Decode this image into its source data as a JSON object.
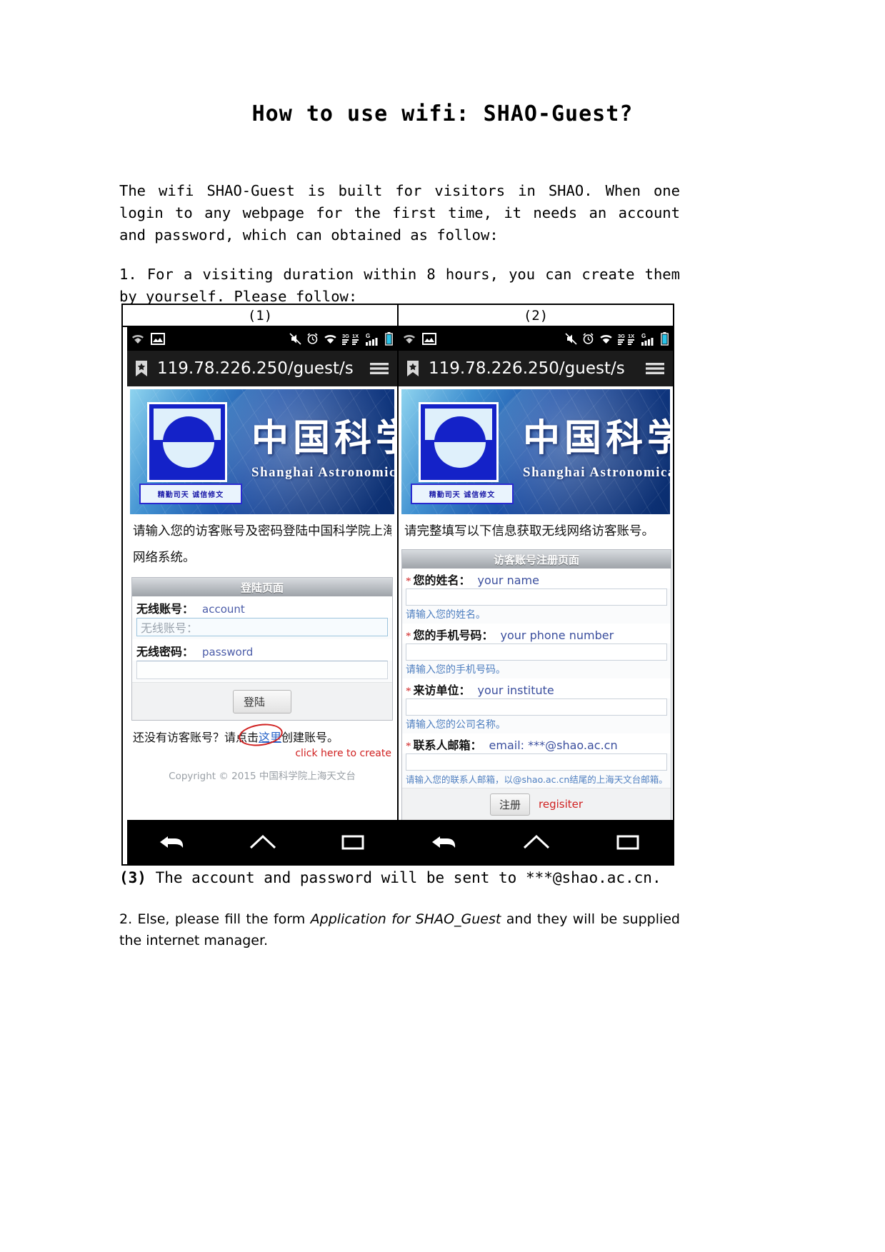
{
  "document": {
    "title": "How to use wifi: SHAO-Guest?",
    "intro": "The wifi SHAO-Guest is built for visitors in SHAO. When one login to any webpage for the first time, it needs an account and password, which can obtained as follow:",
    "step1": "1. For a visiting duration within 8 hours, you can create them by yourself. Please follow:",
    "step3_number": "(3)",
    "step3_text": "  The account and password will be sent to ***@shao.ac.cn.",
    "step2_prefix": "2. Else, please fill the form ",
    "step2_italic": "Application for SHAO_Guest",
    "step2_suffix": " and they will be supplied the internet manager."
  },
  "table": {
    "headers": [
      "(1)",
      "(2)"
    ]
  },
  "phone": {
    "statusbar": {
      "left_icons": [
        "wifi-question-icon",
        "image-icon"
      ],
      "right_icons": [
        "mute-icon",
        "alarm-clock-icon",
        "wifi-icon",
        "3g-1x-signal-icon",
        "g-signal-icon",
        "battery-icon"
      ]
    },
    "browser": {
      "bookmark_icon": "bookmark-star-icon",
      "url": "119.78.226.250/guest/s",
      "menu_icon": "hamburger-menu-icon"
    },
    "navbar": {
      "back": "back-arrow-icon",
      "home": "home-icon",
      "recents": "recents-square-icon"
    }
  },
  "banner": {
    "logo_motto": "精勤司天 诚信修文",
    "chinese_name": "中国科学",
    "english_name": "Shanghai Astronomical"
  },
  "panel1": {
    "lead_line1": "请输入您的访客账号及密码登陆中国科学院上海天",
    "lead_line2": "网络系统。",
    "card_title": "登陆页面",
    "account_label": "无线账号：",
    "account_annotation": "account",
    "account_placeholder": "无线账号：",
    "password_label": "无线密码：",
    "password_annotation": "password",
    "password_value": "",
    "login_button": "登陆",
    "create_prefix": "还没有访客账号？请点击",
    "create_link": "这里",
    "create_suffix": "创建账号。",
    "create_annotation": "click here to create",
    "copyright": "Copyright © 2015 中国科学院上海天文台"
  },
  "panel2": {
    "lead": "请完整填写以下信息获取无线网络访客账号。",
    "card_title": "访客账号注册页面",
    "fields": [
      {
        "required": "*",
        "label": "您的姓名：",
        "annotation": "your name",
        "value": "",
        "hint": "请输入您的姓名。"
      },
      {
        "required": "*",
        "label": "您的手机号码：",
        "annotation": "your phone number",
        "value": "",
        "hint": "请输入您的手机号码。"
      },
      {
        "required": "*",
        "label": "来访单位：",
        "annotation": "your institute",
        "value": "",
        "hint": "请输入您的公司名称。"
      },
      {
        "required": "*",
        "label": "联系人邮箱：",
        "annotation": "email: ***@shao.ac.cn",
        "value": "",
        "hint": "请输入您的联系人邮箱，以@shao.ac.cn结尾的上海天文台邮箱。"
      }
    ],
    "register_button": "注册",
    "register_annotation": "regisiter"
  },
  "colors": {
    "accent_blue": "#2864c8",
    "annotation_red": "#d02020",
    "hint_blue": "#4f7fc0",
    "status_black": "#000000",
    "battery_cyan": "#29c3e8"
  }
}
